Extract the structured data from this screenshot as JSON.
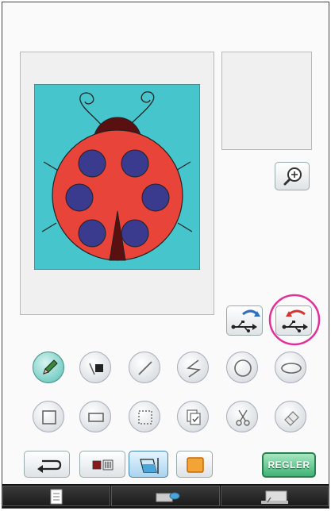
{
  "canvas": {
    "background": "#46c6cc",
    "shell_color": "#e8443a",
    "spot_color": "#3a3a8f",
    "head_color": "#5a1010"
  },
  "toolbar": {
    "regler_label": "REGLER",
    "accent_green": "#3fb374"
  },
  "tools": [
    {
      "name": "pencil",
      "icon": "pencil-icon",
      "active": true
    },
    {
      "name": "fill-line",
      "icon": "fill-line-icon"
    },
    {
      "name": "straight-line",
      "icon": "straight-line-icon"
    },
    {
      "name": "zigzag-line",
      "icon": "zigzag-line-icon"
    },
    {
      "name": "circle-shape",
      "icon": "circle-shape-icon"
    },
    {
      "name": "ellipse-shape",
      "icon": "ellipse-shape-icon"
    },
    {
      "name": "square-shape",
      "icon": "square-shape-icon"
    },
    {
      "name": "rectangle-shape",
      "icon": "rectangle-shape-icon"
    },
    {
      "name": "select-area",
      "icon": "select-area-icon"
    },
    {
      "name": "paste",
      "icon": "paste-icon"
    },
    {
      "name": "cut",
      "icon": "scissors-icon"
    },
    {
      "name": "eraser",
      "icon": "eraser-icon"
    }
  ],
  "highlight_color": "#e0309a"
}
